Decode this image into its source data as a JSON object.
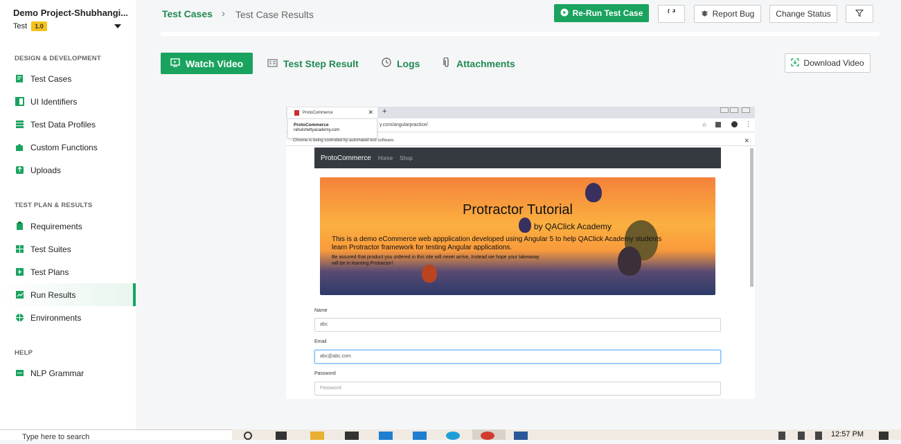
{
  "sidebar": {
    "project": "Demo Project-Shubhangi...",
    "version_label": "Test",
    "version_badge": "1.0",
    "sections": [
      {
        "title": "DESIGN & DEVELOPMENT",
        "items": [
          "Test Cases",
          "UI Identifiers",
          "Test Data Profiles",
          "Custom Functions",
          "Uploads"
        ]
      },
      {
        "title": "TEST PLAN & RESULTS",
        "items": [
          "Requirements",
          "Test Suites",
          "Test Plans",
          "Run Results",
          "Environments"
        ]
      },
      {
        "title": "HELP",
        "items": [
          "NLP Grammar"
        ]
      }
    ],
    "active_item": "Run Results"
  },
  "header": {
    "breadcrumb_root": "Test Cases",
    "breadcrumb_current": "Test Case Results",
    "rerun_label": "Re-Run Test Case",
    "report_bug_label": "Report Bug",
    "change_status_label": "Change Status"
  },
  "tabs": [
    {
      "label": "Watch Video",
      "active": true
    },
    {
      "label": "Test Step Result",
      "active": false
    },
    {
      "label": "Logs",
      "active": false
    },
    {
      "label": "Attachments",
      "active": false
    }
  ],
  "download_label": "Download Video",
  "video": {
    "tab_title": "ProtoCommerce",
    "tooltip_title": "ProtoCommerce",
    "tooltip_url": "rahulshettyacademy.com",
    "address": "y.com/angularpractice/",
    "automation_notice": "Chrome is being controlled by automated test software.",
    "brand": "ProtoCommerce",
    "nav_links": [
      "Home",
      "Shop"
    ],
    "banner_title": "Protractor Tutorial",
    "banner_subtitle": "by QAClick Academy",
    "banner_line1": "This is a demo eCommerce web appplication developed using Angular 5 to help QAClick Academy students",
    "banner_line2": "learn Protractor framework for testing Angular applications.",
    "banner_line3": "Be assured that product you ordered in this site will never arrive, Instead we hope your takeaway",
    "banner_line4": "will be in learning Protractor!",
    "fields": [
      {
        "label": "Name",
        "value": "abc",
        "focused": false
      },
      {
        "label": "Email",
        "value": "abc@abc.com",
        "focused": true
      },
      {
        "label": "Password",
        "value": "Password",
        "focused": false
      }
    ]
  },
  "taskbar": {
    "search_text": "Type here to search",
    "time": "12:57 PM"
  },
  "colors": {
    "accent": "#1aa35f",
    "accent_text": "#1f8a52",
    "badge": "#f4c21b"
  }
}
